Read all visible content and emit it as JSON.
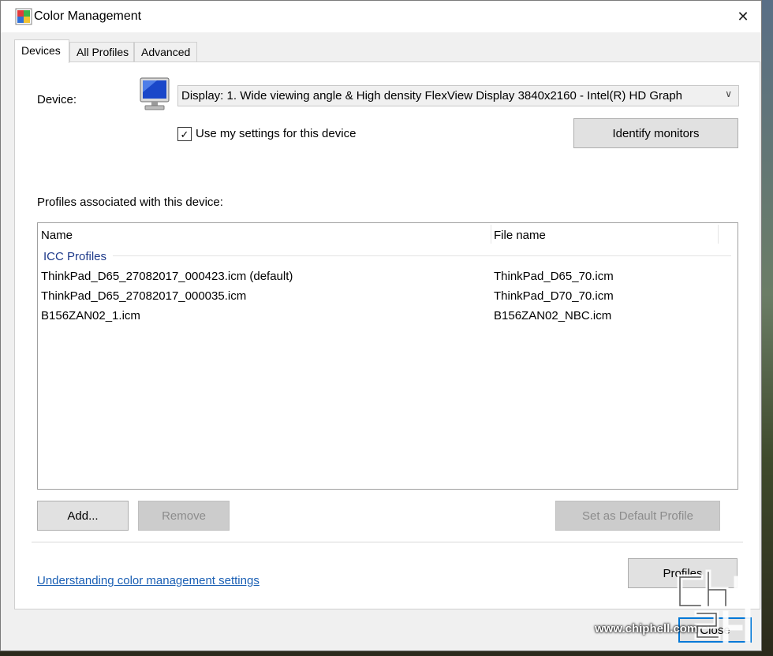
{
  "window": {
    "title": "Color Management",
    "close_glyph": "✕"
  },
  "tabs": [
    {
      "label": "Devices",
      "active": true
    },
    {
      "label": "All Profiles",
      "active": false
    },
    {
      "label": "Advanced",
      "active": false
    }
  ],
  "device": {
    "label": "Device:",
    "selected": "Display: 1. Wide viewing angle & High density FlexView Display 3840x2160 - Intel(R) HD Graph",
    "icon": "monitor-icon",
    "use_settings_label": "Use my settings for this device",
    "use_settings_checked": true,
    "identify_button": "Identify monitors"
  },
  "profiles": {
    "label": "Profiles associated with this device:",
    "columns": [
      "Name",
      "File name"
    ],
    "group": "ICC Profiles",
    "rows": [
      {
        "name": "ThinkPad_D65_27082017_000423.icm (default)",
        "file": "ThinkPad_D65_70.icm"
      },
      {
        "name": "ThinkPad_D65_27082017_000035.icm",
        "file": "ThinkPad_D70_70.icm"
      },
      {
        "name": "B156ZAN02_1.icm",
        "file": "B156ZAN02_NBC.icm"
      }
    ]
  },
  "buttons": {
    "add": "Add...",
    "remove": "Remove",
    "set_default": "Set as Default Profile",
    "profiles": "Profiles",
    "close": "Close"
  },
  "link": "Understanding color management settings",
  "watermark": {
    "url": "www.chiphell.com"
  },
  "colors": {
    "accent": "#0078d7",
    "link": "#1a5fb4",
    "group": "#1e3a8a"
  }
}
